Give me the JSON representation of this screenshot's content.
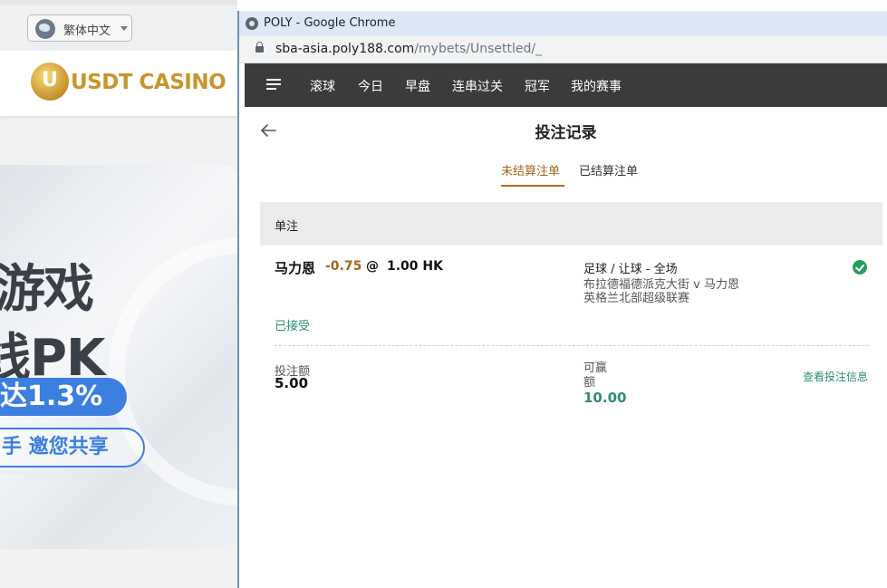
{
  "background_site": {
    "language": "繁体中文",
    "logo": "USDT CASINO",
    "banner_lines": [
      "游戏",
      "线PK",
      "达1.3%",
      "手 邀您共享"
    ]
  },
  "browser": {
    "title": "POLY - Google Chrome",
    "url_host": "sba-asia.poly188.com",
    "url_path": "/mybets/Unsettled/_"
  },
  "nav": {
    "items": [
      "滚球",
      "今日",
      "早盘",
      "连串过关",
      "冠军",
      "我的赛事"
    ]
  },
  "page": {
    "title": "投注记录",
    "tabs": [
      {
        "label": "未结算注单",
        "active": true
      },
      {
        "label": "已结算注单",
        "active": false
      }
    ],
    "section": "单注"
  },
  "bet": {
    "selection": "马力恩",
    "handicap": "-0.75",
    "at": "@",
    "odds": "1.00 HK",
    "market": "足球 / 让球 - 全场",
    "teams": "布拉德福德派克大街 v 马力恩",
    "league": "英格兰北部超级联赛",
    "status": "已接受",
    "stake_label": "投注额",
    "stake_value": "5.00",
    "win_label": "可赢额",
    "win_value": "10.00",
    "details_link": "查看投注信息"
  },
  "colors": {
    "nav_bg": "#3b3b3b",
    "accent_orange": "#b46a1f",
    "accent_green": "#2f8f6a",
    "check_green": "#24a05c"
  }
}
